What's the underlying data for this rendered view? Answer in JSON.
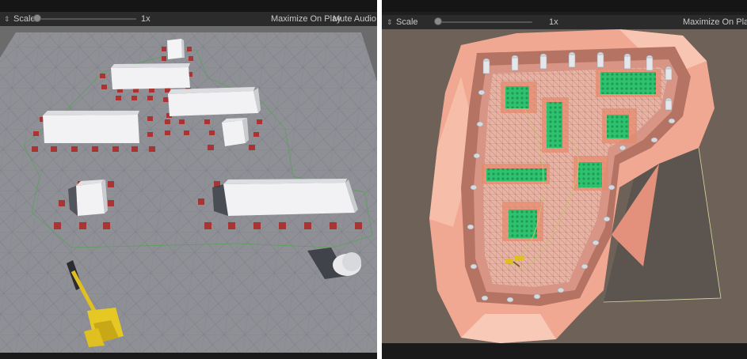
{
  "left_view": {
    "toolbar": {
      "scale_label": "Scale",
      "scale_value": "1x",
      "maximize_on_play_label": "Maximize On Play",
      "mute_audio_label": "Mute Audio"
    },
    "viewport_name": "construction-site-perspective-view"
  },
  "right_view": {
    "toolbar": {
      "scale_label": "Scale",
      "scale_value": "1x",
      "maximize_on_play_label": "Maximize On Play"
    },
    "viewport_name": "terrain-excavation-top-view"
  },
  "colors": {
    "toolbar_bg": "#2b2b2b",
    "toolbar_text": "#c8c8c8",
    "ground": "#8e9096",
    "building": "#f2f2f4",
    "column_base": "#a83434",
    "excavator": "#e0c020",
    "terrain": "#f0a892",
    "foundation_green": "#2ec26e",
    "background_brown": "#6e6158"
  }
}
